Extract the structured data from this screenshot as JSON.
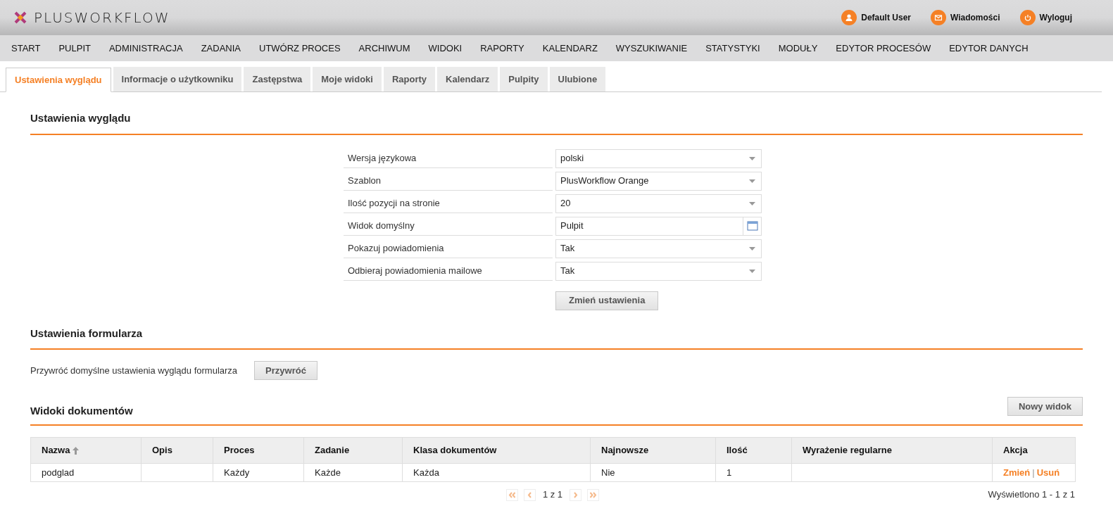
{
  "header": {
    "logo": "PLUSWORKFLOW",
    "user_links": [
      {
        "kind": "user",
        "label": "Default User"
      },
      {
        "kind": "mail",
        "label": "Wiadomości"
      },
      {
        "kind": "power",
        "label": "Wyloguj"
      }
    ]
  },
  "main_menu": [
    "START",
    "PULPIT",
    "ADMINISTRACJA",
    "ZADANIA",
    "UTWÓRZ PROCES",
    "ARCHIWUM",
    "WIDOKI",
    "RAPORTY",
    "KALENDARZ",
    "WYSZUKIWANIE",
    "STATYSTYKI",
    "MODUŁY",
    "EDYTOR PROCESÓW",
    "EDYTOR DANYCH"
  ],
  "tabs": [
    {
      "label": "Ustawienia wyglądu",
      "selected": true
    },
    {
      "label": "Informacje o użytkowniku",
      "selected": false
    },
    {
      "label": "Zastępstwa",
      "selected": false
    },
    {
      "label": "Moje widoki",
      "selected": false
    },
    {
      "label": "Raporty",
      "selected": false
    },
    {
      "label": "Kalendarz",
      "selected": false
    },
    {
      "label": "Pulpity",
      "selected": false
    },
    {
      "label": "Ulubione",
      "selected": false
    }
  ],
  "appearance": {
    "title": "Ustawienia wyglądu",
    "fields": [
      {
        "label": "Wersja językowa",
        "kind": "select",
        "value": "polski"
      },
      {
        "label": "Szablon",
        "kind": "select",
        "value": "PlusWorkflow Orange"
      },
      {
        "label": "Ilość pozycji na stronie",
        "kind": "select",
        "value": "20"
      },
      {
        "label": "Widok domyślny",
        "kind": "picker",
        "value": "Pulpit"
      },
      {
        "label": "Pokazuj powiadomienia",
        "kind": "select",
        "value": "Tak"
      },
      {
        "label": "Odbieraj powiadomienia mailowe",
        "kind": "select",
        "value": "Tak"
      }
    ],
    "button": "Zmień ustawienia"
  },
  "form_settings": {
    "title": "Ustawienia formularza",
    "text": "Przywróć domyślne ustawienia wyglądu formularza",
    "button": "Przywróć"
  },
  "document_views": {
    "title": "Widoki dokumentów",
    "button": "Nowy widok",
    "table": {
      "columns": [
        {
          "label": "Nazwa",
          "sorted": true
        },
        {
          "label": "Opis",
          "sorted": false
        },
        {
          "label": "Proces",
          "sorted": false
        },
        {
          "label": "Zadanie",
          "sorted": false
        },
        {
          "label": "Klasa dokumentów",
          "sorted": false
        },
        {
          "label": "Najnowsze",
          "sorted": false
        },
        {
          "label": "Ilość",
          "sorted": false
        },
        {
          "label": "Wyrażenie regularne",
          "sorted": false
        },
        {
          "label": "Akcja",
          "sorted": false
        }
      ],
      "rows": [
        {
          "cells": [
            "podglad",
            "",
            "Każdy",
            "Każde",
            "Każda",
            "Nie",
            "1",
            ""
          ],
          "actions": [
            "Zmień",
            "Usuń"
          ],
          "separator": "|"
        }
      ]
    },
    "pager": {
      "page": "1 z 1",
      "summary": "Wyświetlono 1 - 1 z 1"
    }
  }
}
